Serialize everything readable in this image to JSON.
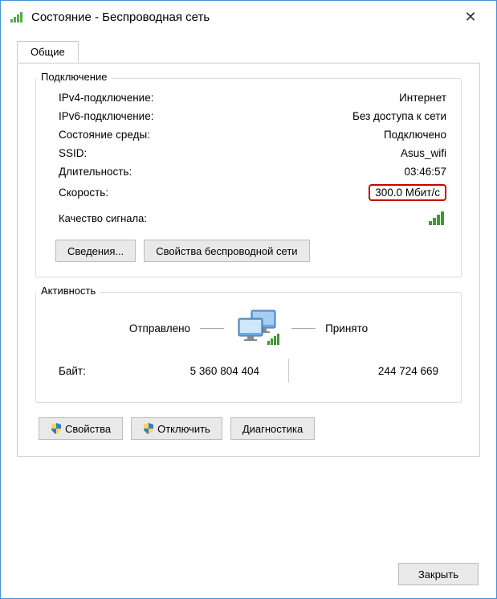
{
  "window": {
    "title": "Состояние - Беспроводная сеть"
  },
  "tab": {
    "general": "Общие"
  },
  "connection": {
    "group_title": "Подключение",
    "ipv4_label": "IPv4-подключение:",
    "ipv4_value": "Интернет",
    "ipv6_label": "IPv6-подключение:",
    "ipv6_value": "Без доступа к сети",
    "media_label": "Состояние среды:",
    "media_value": "Подключено",
    "ssid_label": "SSID:",
    "ssid_value": "Asus_wifi",
    "duration_label": "Длительность:",
    "duration_value": "03:46:57",
    "speed_label": "Скорость:",
    "speed_value": "300.0 Мбит/c",
    "signal_label": "Качество сигнала:"
  },
  "buttons": {
    "details": "Сведения...",
    "wireless_props": "Свойства беспроводной сети",
    "properties": "Свойства",
    "disable": "Отключить",
    "diagnose": "Диагностика",
    "close": "Закрыть"
  },
  "activity": {
    "group_title": "Активность",
    "sent_label": "Отправлено",
    "recv_label": "Принято",
    "bytes_label": "Байт:",
    "sent_bytes": "5 360 804 404",
    "recv_bytes": "244 724 669"
  }
}
